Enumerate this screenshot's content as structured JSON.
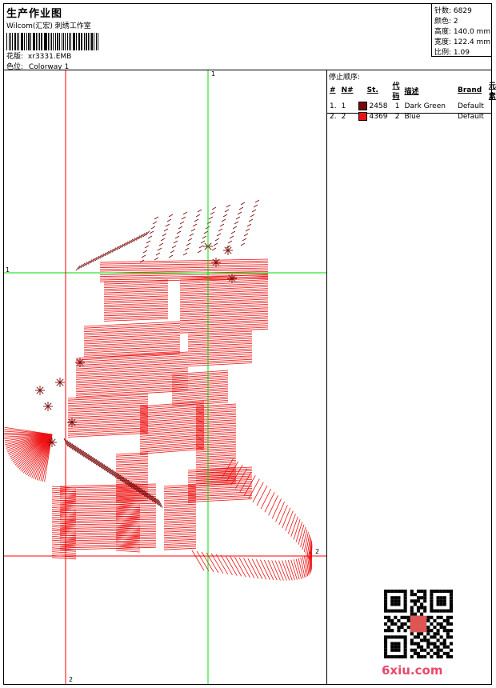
{
  "header": {
    "title": "生产作业图",
    "company": "Wilcom(汇宏) 刺绣工作室",
    "design_label": "花版:",
    "design_value": "xr3331.EMB",
    "colorway_label": "色位:",
    "colorway_value": "Colorway 1"
  },
  "stats": [
    {
      "label": "针数:",
      "value": "6829"
    },
    {
      "label": "颜色:",
      "value": "2"
    },
    {
      "label": "高度:",
      "value": "140.0 mm"
    },
    {
      "label": "宽度:",
      "value": "122.4 mm"
    },
    {
      "label": "比例:",
      "value": "1.09"
    }
  ],
  "stop_sequence": {
    "title": "停止顺序:",
    "headers": [
      "#",
      "N#",
      "St.",
      "代码",
      "描述",
      "Brand",
      "元素"
    ],
    "rows": [
      {
        "idx": "1.",
        "n": "1",
        "code_color": "#7a0a0a",
        "stitches": "2458",
        "code": "1",
        "desc": "Dark Green",
        "brand": "Default"
      },
      {
        "idx": "2.",
        "n": "2",
        "code_color": "#ee1111",
        "stitches": "4369",
        "code": "2",
        "desc": "Blue",
        "brand": "Default"
      }
    ]
  },
  "guides": {
    "top_v": "1",
    "left_h": "1",
    "right_h": "2",
    "bottom_v": "2"
  },
  "colors": {
    "thread_dark": "#7a0a0a",
    "thread_red": "#ee1111",
    "guide_green": "#00dd00",
    "guide_red": "#ff0000"
  },
  "watermark": "6xiu.com"
}
